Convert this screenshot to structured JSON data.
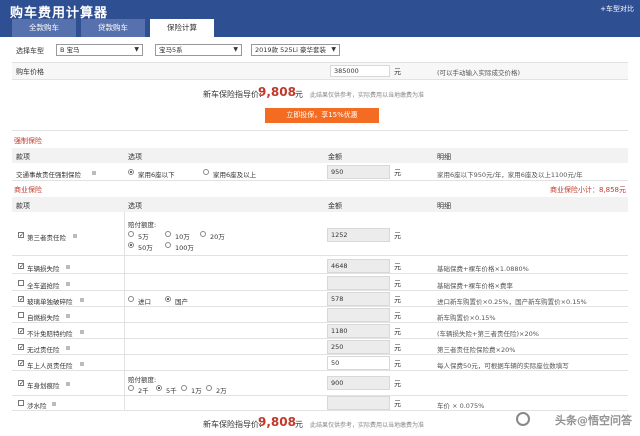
{
  "header": {
    "title": "购车费用计算器",
    "link": "+车型对比",
    "tabs": [
      "全款购车",
      "贷款购车",
      "保险计算"
    ]
  },
  "selectors": {
    "label": "选择车型",
    "brand": "B 宝马",
    "series": "宝马5系",
    "model": "2019款 525Li 豪华套装"
  },
  "price": {
    "label": "购车价格",
    "value": "385000",
    "unit": "元",
    "note": "(可以手动输入实际成交价格)"
  },
  "guide": {
    "label": "新车保险指导价:",
    "value": "9,808",
    "unit": "元",
    "note": "此结果仅供参考，实际费用以当地缴费为准"
  },
  "cta": "立即投保，享15%优惠",
  "mandatory": {
    "title": "强制保险",
    "headers": [
      "款项",
      "选项",
      "金额",
      "明细"
    ],
    "row": {
      "name": "交通事故责任强制保险",
      "opt1": "家用6座以下",
      "opt2": "家用6座及以上",
      "amount": "950",
      "unit": "元",
      "detail": "家用6座以下950元/年，家用6座及以上1100元/年"
    }
  },
  "commercial": {
    "title": "商业保险",
    "subtotal": "商业保险小计：8,858元",
    "headers": [
      "款项",
      "选项",
      "金额",
      "明细"
    ],
    "third_party": {
      "name": "第三者责任险",
      "limit_label": "赔付额度:",
      "options": [
        "5万",
        "10万",
        "20万",
        "50万",
        "100万"
      ],
      "amount": "1252",
      "unit": "元"
    },
    "rows": [
      {
        "name": "车辆损失险",
        "checked": true,
        "amount": "4648",
        "unit": "元",
        "detail": "基础保费+裸车价格×1.0880%"
      },
      {
        "name": "全车盗抢险",
        "checked": false,
        "amount": "",
        "unit": "元",
        "detail": "基础保费+裸车价格×费率"
      },
      {
        "name": "玻璃单独破碎险",
        "checked": true,
        "amount": "578",
        "unit": "元",
        "detail": "进口新车购置价×0.25%，国产新车购置价×0.15%",
        "opt1": "进口",
        "opt2": "国产"
      },
      {
        "name": "自燃损失险",
        "checked": false,
        "amount": "",
        "unit": "元",
        "detail": "新车购置价×0.15%"
      },
      {
        "name": "不计免赔特约险",
        "checked": true,
        "amount": "1180",
        "unit": "元",
        "detail": "(车辆损失险+第三者责任险)×20%"
      },
      {
        "name": "无过责任险",
        "checked": true,
        "amount": "250",
        "unit": "元",
        "detail": "第三者责任险保险费×20%"
      },
      {
        "name": "车上人员责任险",
        "checked": true,
        "amount": "50",
        "unit": "元",
        "detail": "每人保费50元，可根据车辆的实际座位数填写"
      }
    ],
    "body_scratch": {
      "name": "车身划痕险",
      "limit_label": "赔付额度:",
      "options": [
        "2千",
        "5千",
        "1万",
        "2万"
      ],
      "amount": "900",
      "unit": "元"
    },
    "wading": {
      "name": "涉水险",
      "amount": "",
      "unit": "元",
      "detail": "车价 × 0.075%"
    }
  },
  "watermark": "头条@悟空问答"
}
